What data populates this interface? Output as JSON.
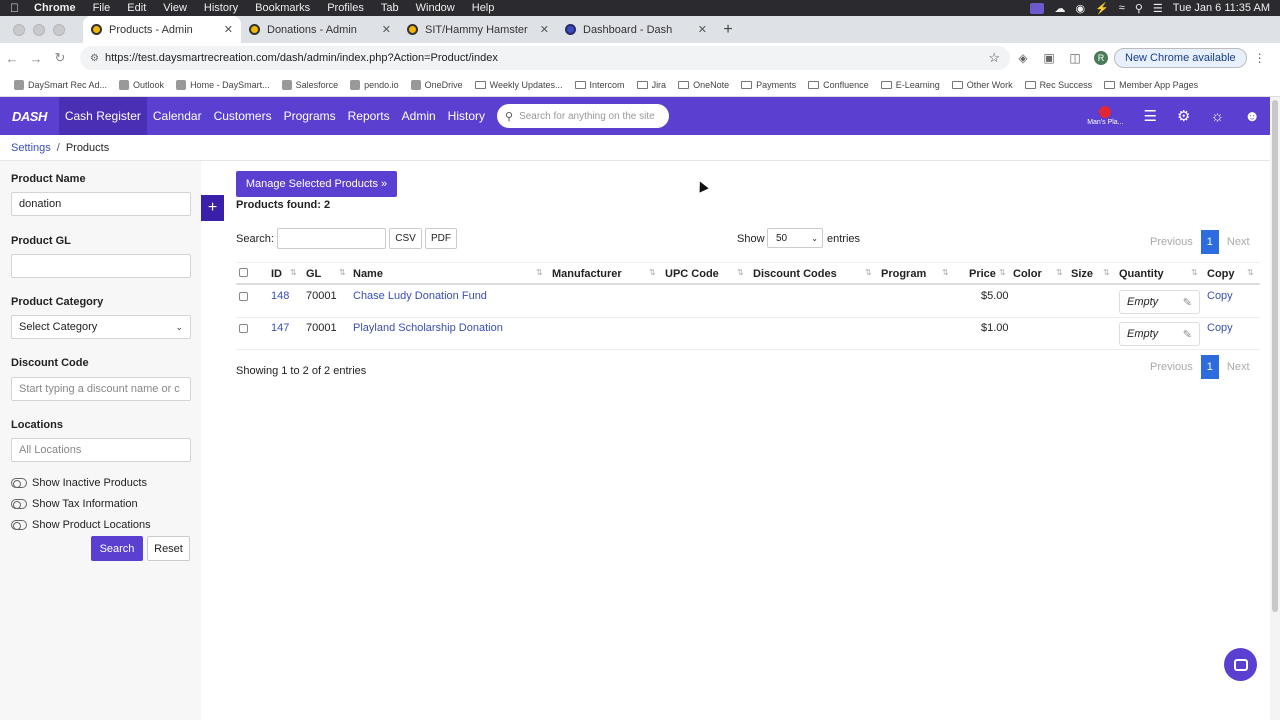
{
  "os_menubar": {
    "app": "Chrome",
    "menus": [
      "File",
      "Edit",
      "View",
      "History",
      "Bookmarks",
      "Profiles",
      "Tab",
      "Window",
      "Help"
    ],
    "clock": "Tue Jan 6  11:35 AM"
  },
  "browser": {
    "tabs": [
      {
        "title": "Products - Admin",
        "active": true
      },
      {
        "title": "Donations - Admin",
        "active": false
      },
      {
        "title": "SIT/Hammy Hamster",
        "active": false
      },
      {
        "title": "Dashboard - Dash",
        "active": false
      }
    ],
    "url": "https://test.daysmartrecreation.com/dash/admin/index.php?Action=Product/index",
    "profile_initial": "R",
    "new_chrome_label": "New Chrome available",
    "bookmarks": [
      {
        "label": "DaySmart Rec Ad...",
        "folder": false
      },
      {
        "label": "Outlook",
        "folder": false
      },
      {
        "label": "Home - DaySmart...",
        "folder": false
      },
      {
        "label": "Salesforce",
        "folder": false
      },
      {
        "label": "pendo.io",
        "folder": false
      },
      {
        "label": "OneDrive",
        "folder": false
      },
      {
        "label": "Weekly Updates...",
        "folder": true
      },
      {
        "label": "Intercom",
        "folder": true
      },
      {
        "label": "Jira",
        "folder": true
      },
      {
        "label": "OneNote",
        "folder": true
      },
      {
        "label": "Payments",
        "folder": true
      },
      {
        "label": "Confluence",
        "folder": true
      },
      {
        "label": "E-Learning",
        "folder": true
      },
      {
        "label": "Other Work",
        "folder": true
      },
      {
        "label": "Rec Success",
        "folder": true
      },
      {
        "label": "Member App Pages",
        "folder": true
      }
    ]
  },
  "app_nav": {
    "logo": "DASH",
    "items": [
      "Cash Register",
      "Calendar",
      "Customers",
      "Programs",
      "Reports",
      "Admin",
      "History"
    ],
    "active": "Cash Register",
    "search_placeholder": "Search for anything on the site",
    "location_label": "Man's Pla..."
  },
  "breadcrumb": {
    "parent": "Settings",
    "separator": "/",
    "current": "Products"
  },
  "filters": {
    "product_name_label": "Product Name",
    "product_name_value": "donation",
    "product_gl_label": "Product GL",
    "product_gl_value": "",
    "product_category_label": "Product Category",
    "product_category_value": "Select Category",
    "discount_code_label": "Discount Code",
    "discount_code_placeholder": "Start typing a discount name or c",
    "locations_label": "Locations",
    "locations_placeholder": "All Locations",
    "toggles": [
      "Show Inactive Products",
      "Show Tax Information",
      "Show Product Locations"
    ],
    "search_button": "Search",
    "reset_button": "Reset"
  },
  "main": {
    "manage_button": "Manage Selected Products »",
    "add_button": "+",
    "products_found": "Products found: 2",
    "search_label": "Search:",
    "csv_button": "CSV",
    "pdf_button": "PDF",
    "show_label": "Show",
    "show_value": "50",
    "entries_label": "entries",
    "pagination": {
      "previous": "Previous",
      "page": "1",
      "next": "Next"
    },
    "table": {
      "headers": [
        "ID",
        "GL",
        "Name",
        "Manufacturer",
        "UPC Code",
        "Discount Codes",
        "Program",
        "Price",
        "Color",
        "Size",
        "Quantity",
        "Copy"
      ],
      "rows": [
        {
          "id": "148",
          "gl": "70001",
          "name": "Chase Ludy Donation Fund",
          "price": "$5.00",
          "quantity": "Empty",
          "copy": "Copy"
        },
        {
          "id": "147",
          "gl": "70001",
          "name": "Playland Scholarship Donation",
          "price": "$1.00",
          "quantity": "Empty",
          "copy": "Copy"
        }
      ]
    },
    "showing_text": "Showing 1 to 2 of 2 entries"
  },
  "colors": {
    "brand": "#5b3fd0",
    "link": "#3a4fb5",
    "page_active": "#2d6cdf"
  }
}
